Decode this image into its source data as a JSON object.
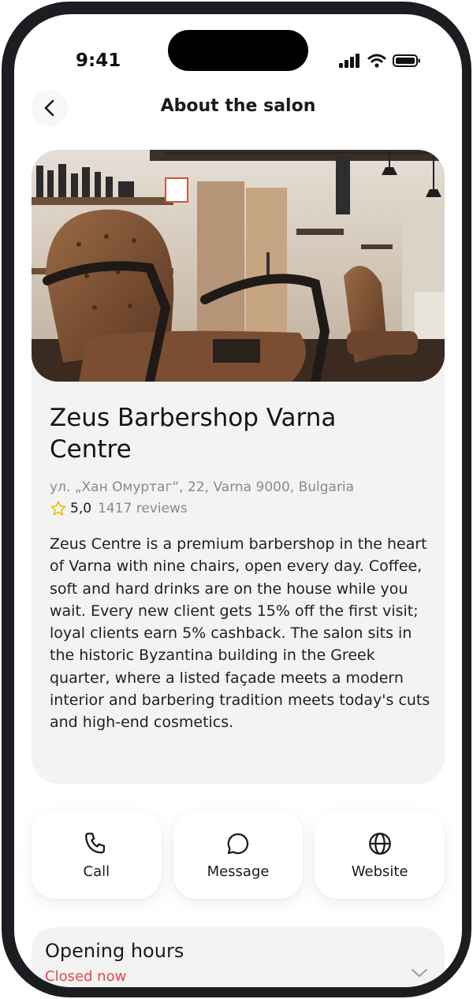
{
  "status_bar": {
    "time": "9:41"
  },
  "header": {
    "title": "About the salon"
  },
  "salon": {
    "name": "Zeus Barbershop Varna Centre",
    "address": "ул. „Хан Омуртаг“, 22, Varna 9000, Bulgaria",
    "rating": "5,0",
    "reviews": "1417 reviews",
    "description": "Zeus Centre is a premium barbershop in the heart of Varna with nine chairs, open every day. Coffee, soft and hard drinks are on the house while you wait. Every new client gets 15% off the first visit; loyal clients earn 5% cashback. The salon sits in the historic Byzantina building in the Greek quarter, where a listed façade meets a modern interior and barbering tradition meets today's cuts and high-end cosmetics."
  },
  "actions": {
    "call": {
      "label": "Call",
      "icon": "phone-icon"
    },
    "message": {
      "label": "Message",
      "icon": "chat-bubble-icon"
    },
    "website": {
      "label": "Website",
      "icon": "globe-icon"
    }
  },
  "opening_hours": {
    "title": "Opening hours",
    "status": "Closed now",
    "status_color": "#e5484d"
  },
  "colors": {
    "star": "#f2c21b",
    "card_bg": "#f3f3f3",
    "frame": "#1c1d20"
  }
}
